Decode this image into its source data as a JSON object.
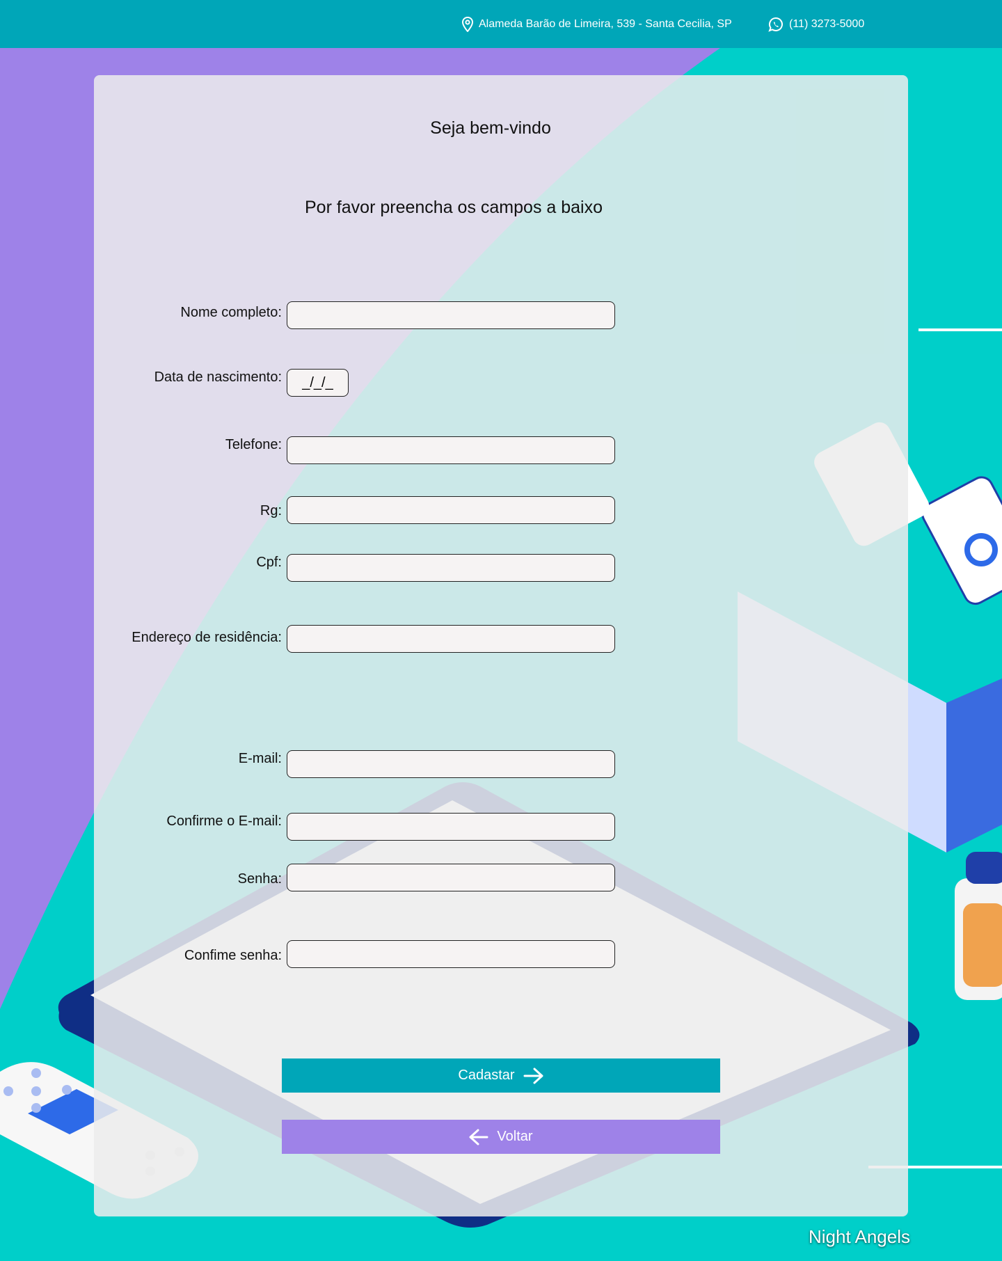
{
  "header": {
    "address": "Alameda Barão de Limeira, 539 - Santa Cecilia, SP",
    "phone": "(11) 3273-5000",
    "address_icon": "location-pin-icon",
    "phone_icon": "whatsapp-icon"
  },
  "form": {
    "title": "Seja bem-vindo",
    "subtitle": "Por favor preencha os campos a baixo",
    "fields": {
      "nome": {
        "label": "Nome completo:",
        "value": ""
      },
      "nascimento": {
        "label": "Data de nascimento:",
        "value": "_/_/_"
      },
      "telefone": {
        "label": "Telefone:",
        "value": ""
      },
      "rg": {
        "label": "Rg:",
        "value": ""
      },
      "cpf": {
        "label": "Cpf:",
        "value": ""
      },
      "endereco": {
        "label": "Endereço de residência:",
        "value": ""
      },
      "email": {
        "label": "E-mail:",
        "value": ""
      },
      "confirm_email": {
        "label": "Confirme o E-mail:",
        "value": ""
      },
      "senha": {
        "label": "Senha:",
        "value": ""
      },
      "confirm_senha": {
        "label": "Confime senha:",
        "value": ""
      }
    },
    "submit_label": "Cadastar",
    "back_label": "Voltar"
  },
  "footer": {
    "brand": "Night Angels"
  },
  "colors": {
    "header": "#00a6b8",
    "background": "#00cfc9",
    "purple": "#9e82e8",
    "primary_button": "#00a6b8",
    "secondary_button": "#9e82e8"
  }
}
